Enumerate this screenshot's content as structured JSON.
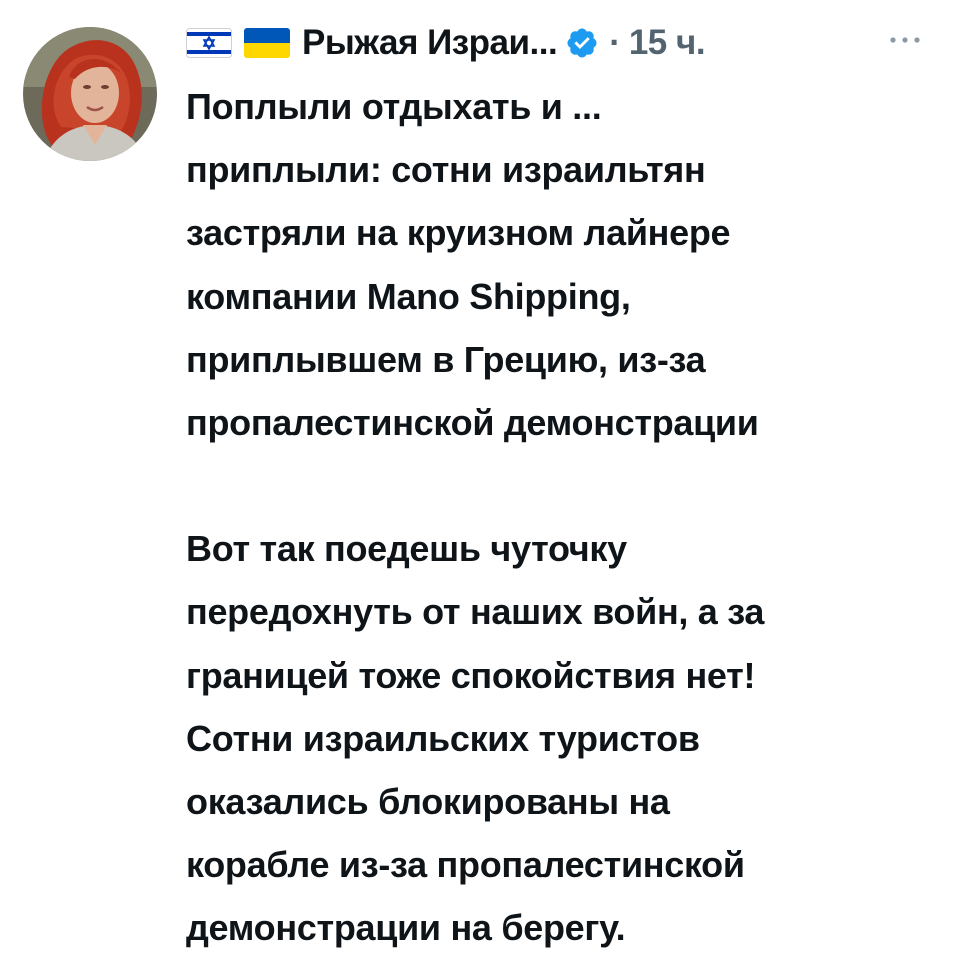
{
  "tweet": {
    "author": {
      "flags": [
        "israel-flag-icon",
        "ukraine-flag-icon"
      ],
      "display_name": "Рыжая Израи...",
      "verified_icon": "verified-badge-icon"
    },
    "separator": "·",
    "timestamp": "15 ч.",
    "more_icon": "more-options-icon",
    "text": {
      "paragraph1": [
        "Поплыли отдыхать и ...",
        "приплыли: сотни израильтян",
        "застряли на круизном лайнере",
        "компании Mano Shipping,",
        "приплывшем в Грецию, из-за",
        "пропалестинской демонстрации"
      ],
      "paragraph2": [
        "Вот так поедешь чуточку",
        "передохнуть от наших войн, а за",
        "границей тоже спокойствия нет!",
        "Сотни израильских туристов",
        "оказались блокированы на",
        "корабле из-за пропалестинской",
        "демонстрации на берегу."
      ]
    },
    "colors": {
      "text": "#0f1419",
      "secondary": "#536471",
      "verified": "#1d9bf0",
      "israel_blue": "#0038b8",
      "ukraine_blue": "#0057b7",
      "ukraine_yellow": "#ffd700",
      "avatar_hair": "#b8321e"
    }
  }
}
